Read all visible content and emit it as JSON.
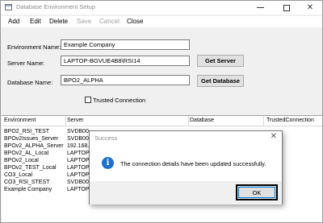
{
  "window": {
    "title": "Database Environment Setup",
    "controls": {
      "minimize": "—",
      "maximize": "☐",
      "close": "✕"
    }
  },
  "menu": {
    "add": "Add",
    "edit": "Edit",
    "delete": "Delete",
    "save": "Save",
    "cancel": "Cancel",
    "close": "Close"
  },
  "form": {
    "environment_label": "Environment Name:",
    "environment_value": "Example Company",
    "server_label": "Server Name:",
    "server_value": "LAPTOP-BGVUE4B8\\RSI14",
    "get_server_label": "Get Server",
    "database_label": "Database Name:",
    "database_value": "BPO2_ALPHA",
    "get_database_label": "Get Database",
    "trusted_label": "Trusted Connection"
  },
  "grid": {
    "headers": [
      "Environment",
      "Server",
      "Database",
      "TrustedConnection"
    ],
    "rows": [
      {
        "environment": "BPO2_RSI_TEST",
        "server": "SVDB00"
      },
      {
        "environment": "BPOv2Issues_Server",
        "server": "SVDB00"
      },
      {
        "environment": "BPOv2_ALPHA_Server",
        "server": "192.168."
      },
      {
        "environment": "BPOv2_AL_Local",
        "server": "LAPTOP"
      },
      {
        "environment": "BPOv2_Local",
        "server": "LAPTOP"
      },
      {
        "environment": "BPOv2_TEST_Local",
        "server": "LAPTOP"
      },
      {
        "environment": "CO3_Local",
        "server": "LAPTOP"
      },
      {
        "environment": "CO3_RSI_STEST",
        "server": "SVDB00"
      },
      {
        "environment": "Example Company",
        "server": "LAPTOP"
      }
    ]
  },
  "dialog": {
    "title": "Success",
    "close_glyph": "✕",
    "icon": "info-icon",
    "icon_glyph": "i",
    "message": "The connection details have been updated successfully.",
    "ok_label": "OK"
  },
  "colors": {
    "info_blue": "#1e6fd0",
    "focus_blue": "#0078d7"
  }
}
